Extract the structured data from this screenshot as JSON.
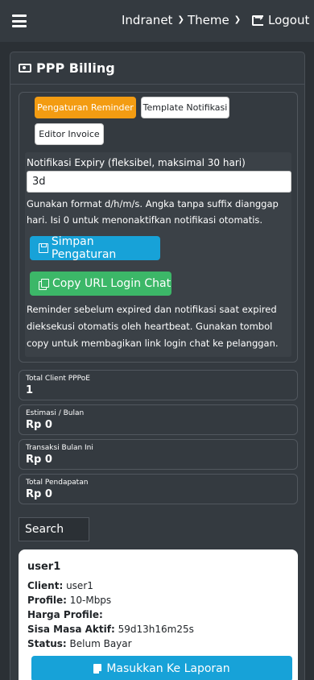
{
  "nav": {
    "brand": "Indranet",
    "theme": "Theme",
    "logout": "Logout"
  },
  "header": {
    "title": "PPP Billing",
    "icon": "money-bill-icon"
  },
  "tabs": {
    "reminder": "Pengaturan Reminder",
    "template": "Template Notifikasi",
    "invoice": "Editor Invoice"
  },
  "form": {
    "label": "Notifikasi Expiry (fleksibel, maksimal 30 hari)",
    "value": "3d",
    "help": "Gunakan format d/h/m/s. Angka tanpa suffix dianggap hari. Isi 0 untuk menonaktifkan notifikasi otomatis.",
    "save_label": "Simpan Pengaturan",
    "copy_label": "Copy URL Login Chat",
    "note": "Reminder sebelum expired dan notifikasi saat expired dieksekusi otomatis oleh heartbeat. Gunakan tombol copy untuk membagikan link login chat ke pelanggan."
  },
  "stats": [
    {
      "label": "Total Client PPPoE",
      "value": "1"
    },
    {
      "label": "Estimasi / Bulan",
      "value": "Rp 0"
    },
    {
      "label": "Transaksi Bulan Ini",
      "value": "Rp 0"
    },
    {
      "label": "Total Pendapatan",
      "value": "Rp 0"
    }
  ],
  "search": {
    "placeholder": "Search"
  },
  "client": {
    "name": "user1",
    "client_label": "Client:",
    "client_value": "user1",
    "profile_label": "Profile:",
    "profile_value": "10-Mbps",
    "harga_label": "Harga Profile:",
    "harga_value": "",
    "sisa_label": "Sisa Masa Aktif:",
    "sisa_value": "59d13h16m25s",
    "status_label": "Status:",
    "status_value": "Belum Bayar",
    "button_label": "Masukkan Ke Laporan"
  },
  "colors": {
    "accent_orange": "#f39c12",
    "accent_blue": "#17a2d8",
    "accent_green": "#3cb768"
  }
}
